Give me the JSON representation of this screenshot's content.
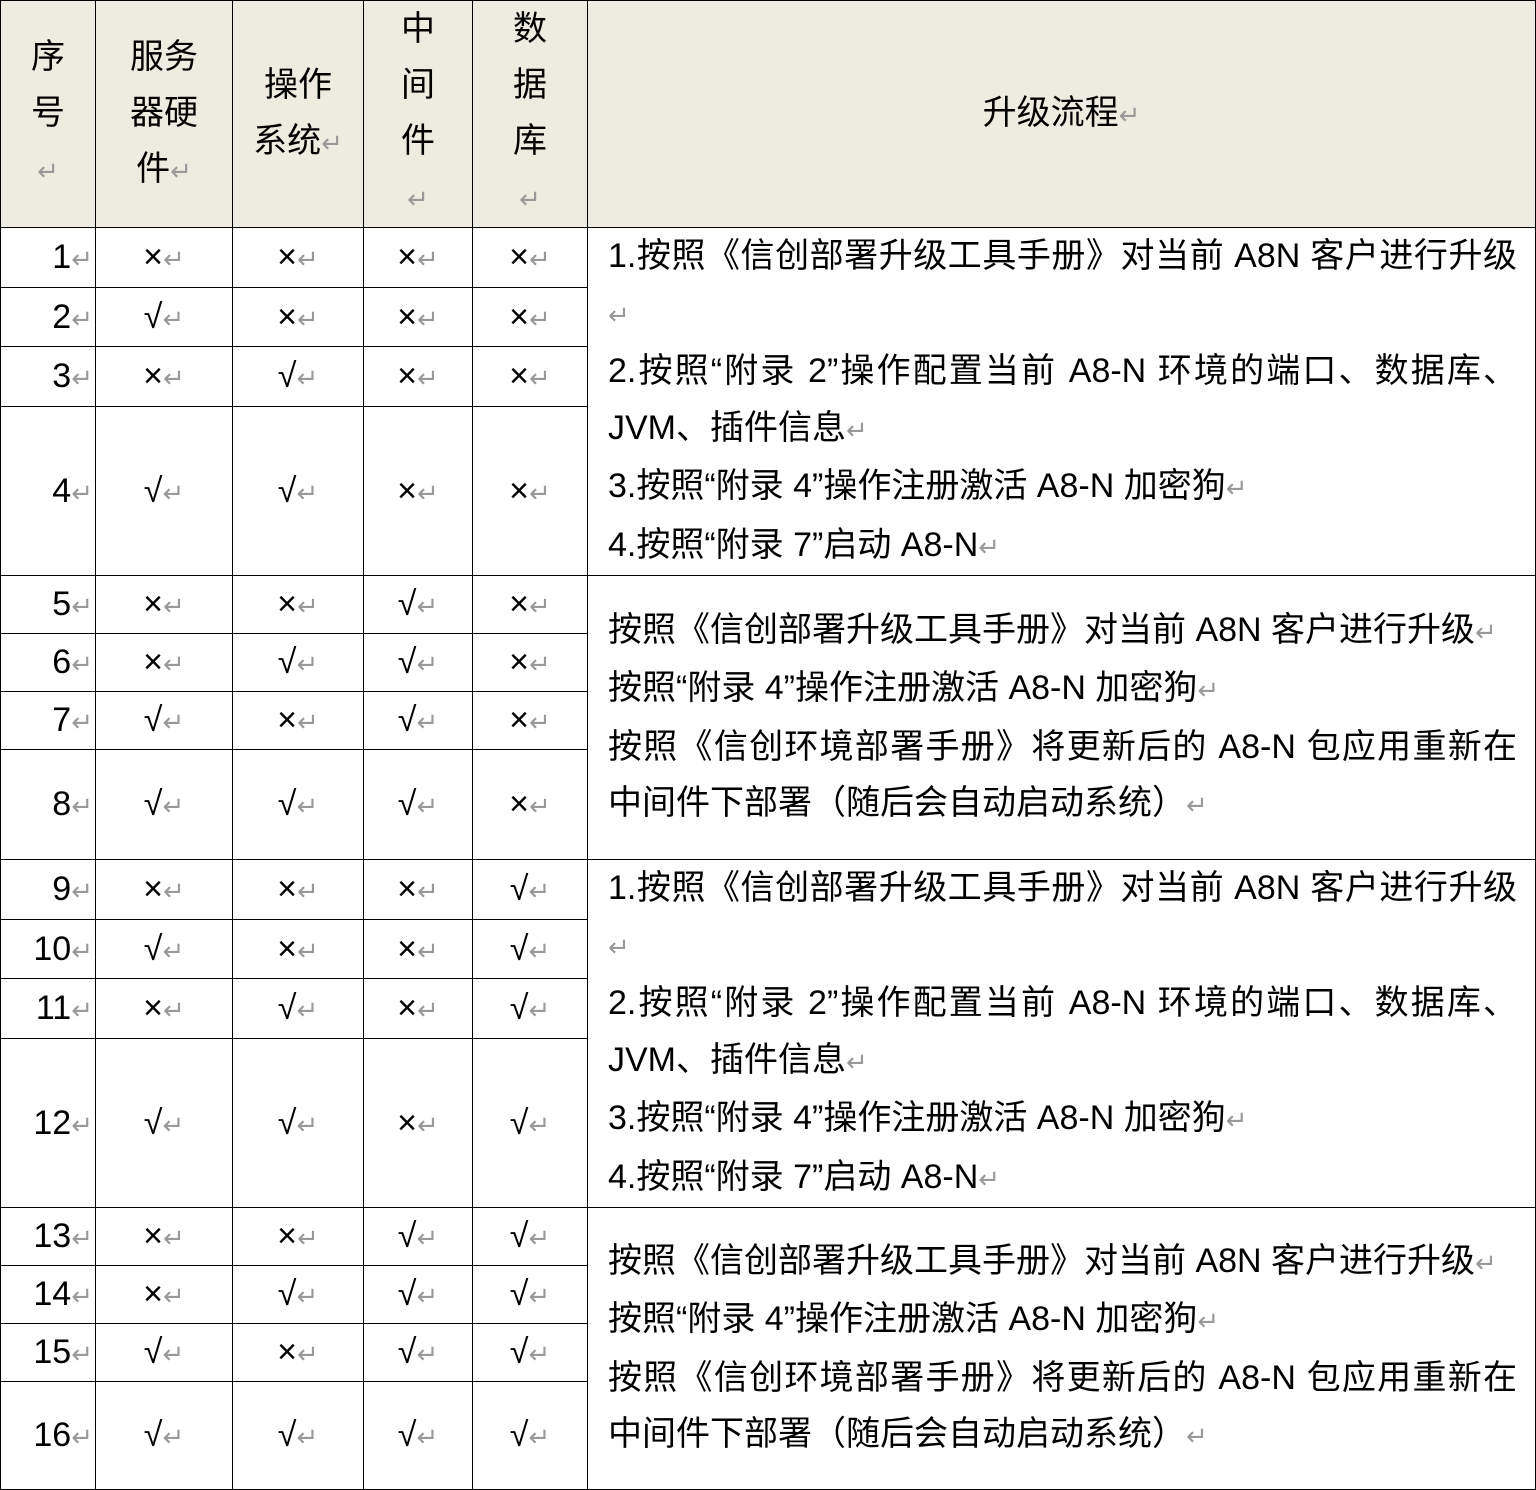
{
  "headers": [
    "序号",
    "服务器硬件",
    "操作系统",
    "中间件",
    "数据库",
    "升级流程"
  ],
  "rows": [
    {
      "no": "1",
      "hw": "×",
      "os": "×",
      "mw": "×",
      "db": "×"
    },
    {
      "no": "2",
      "hw": "√",
      "os": "×",
      "mw": "×",
      "db": "×"
    },
    {
      "no": "3",
      "hw": "×",
      "os": "√",
      "mw": "×",
      "db": "×"
    },
    {
      "no": "4",
      "hw": "√",
      "os": "√",
      "mw": "×",
      "db": "×"
    },
    {
      "no": "5",
      "hw": "×",
      "os": "×",
      "mw": "√",
      "db": "×"
    },
    {
      "no": "6",
      "hw": "×",
      "os": "√",
      "mw": "√",
      "db": "×"
    },
    {
      "no": "7",
      "hw": "√",
      "os": "×",
      "mw": "√",
      "db": "×"
    },
    {
      "no": "8",
      "hw": "√",
      "os": "√",
      "mw": "√",
      "db": "×"
    },
    {
      "no": "9",
      "hw": "×",
      "os": "×",
      "mw": "×",
      "db": "√"
    },
    {
      "no": "10",
      "hw": "√",
      "os": "×",
      "mw": "×",
      "db": "√"
    },
    {
      "no": "11",
      "hw": "×",
      "os": "√",
      "mw": "×",
      "db": "√"
    },
    {
      "no": "12",
      "hw": "√",
      "os": "√",
      "mw": "×",
      "db": "√"
    },
    {
      "no": "13",
      "hw": "×",
      "os": "×",
      "mw": "√",
      "db": "√"
    },
    {
      "no": "14",
      "hw": "×",
      "os": "√",
      "mw": "√",
      "db": "√"
    },
    {
      "no": "15",
      "hw": "√",
      "os": "×",
      "mw": "√",
      "db": "√"
    },
    {
      "no": "16",
      "hw": "√",
      "os": "√",
      "mw": "√",
      "db": "√"
    }
  ],
  "process_groups": [
    [
      "1.按照《信创部署升级工具手册》对当前 A8N 客户进行升级",
      "2.按照“附录 2”操作配置当前 A8-N 环境的端口、数据库、JVM、插件信息",
      "3.按照“附录 4”操作注册激活 A8-N 加密狗",
      "4.按照“附录 7”启动 A8-N"
    ],
    [
      "按照《信创部署升级工具手册》对当前 A8N 客户进行升级",
      "按照“附录 4”操作注册激活 A8-N 加密狗",
      "按照《信创环境部署手册》将更新后的 A8-N 包应用重新在中间件下部署（随后会自动启动系统）"
    ],
    [
      "1.按照《信创部署升级工具手册》对当前 A8N 客户进行升级",
      "2.按照“附录 2”操作配置当前 A8-N 环境的端口、数据库、JVM、插件信息",
      "3.按照“附录 4”操作注册激活 A8-N 加密狗",
      "4.按照“附录 7”启动 A8-N"
    ],
    [
      "按照《信创部署升级工具手册》对当前 A8N 客户进行升级",
      "按照“附录 4”操作注册激活 A8-N 加密狗",
      "按照《信创环境部署手册》将更新后的 A8-N 包应用重新在中间件下部署（随后会自动启动系统）"
    ]
  ]
}
